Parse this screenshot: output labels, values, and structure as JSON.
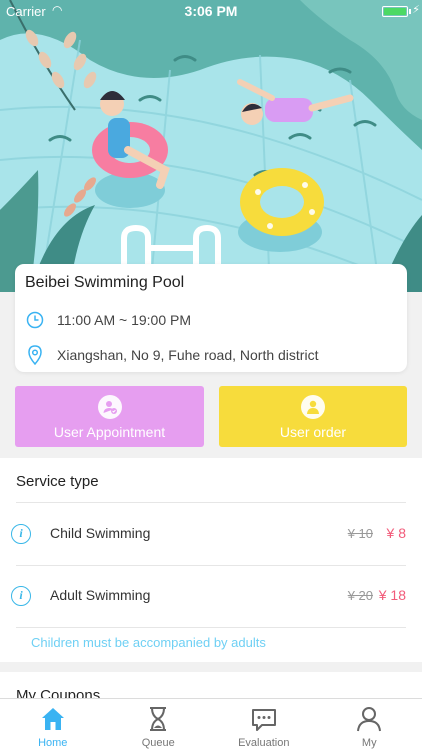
{
  "status_bar": {
    "carrier": "Carrier",
    "time": "3:06 PM"
  },
  "pool": {
    "name": "Beibei Swimming Pool",
    "hours": "11:00 AM ~ 19:00 PM",
    "address": "Xiangshan, No 9, Fuhe road, North district"
  },
  "actions": {
    "appointment_label": "User Appointment",
    "order_label": "User order"
  },
  "services": {
    "title": "Service type",
    "items": [
      {
        "name": "Child Swimming",
        "old_price": "¥ 10",
        "price": "¥ 8"
      },
      {
        "name": "Adult Swimming",
        "old_price": "¥ 20",
        "price": "¥ 18"
      }
    ],
    "note": "Children must be accompanied by adults"
  },
  "coupons": {
    "title": "My Coupons"
  },
  "tabs": [
    {
      "label": "Home",
      "icon": "home-icon",
      "active": true
    },
    {
      "label": "Queue",
      "icon": "hourglass-icon",
      "active": false
    },
    {
      "label": "Evaluation",
      "icon": "chat-bubble-icon",
      "active": false
    },
    {
      "label": "My",
      "icon": "person-icon",
      "active": false
    }
  ],
  "colors": {
    "accent": "#3ab3f2",
    "appointment": "#e69ef0",
    "order": "#f7dc3c",
    "price": "#f25b7a",
    "note": "#6fd0f4",
    "pool_water": "#a9e4ea"
  }
}
